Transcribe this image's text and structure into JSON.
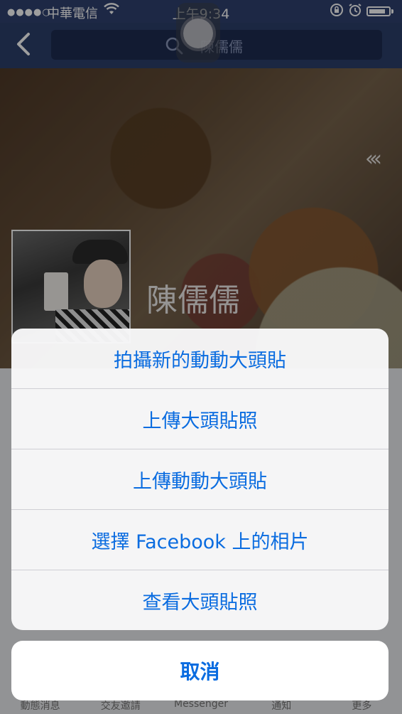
{
  "status_bar": {
    "signal": "●●●●○",
    "carrier": "中華電信",
    "time": "上午9:34",
    "battery_level": 0.85
  },
  "nav": {
    "search_text": "陳儒儒"
  },
  "profile": {
    "name": "陳儒儒"
  },
  "action_sheet": {
    "items": [
      "拍攝新的動動大頭貼",
      "上傳大頭貼照",
      "上傳動動大頭貼",
      "選擇 Facebook 上的相片",
      "查看大頭貼照"
    ],
    "cancel": "取消"
  },
  "tab_bar": {
    "tabs": [
      "動態消息",
      "交友邀請",
      "Messenger",
      "通知",
      "更多"
    ]
  },
  "colors": {
    "nav_bg": "#2d3f6b",
    "action_blue": "#0a6ce0"
  }
}
